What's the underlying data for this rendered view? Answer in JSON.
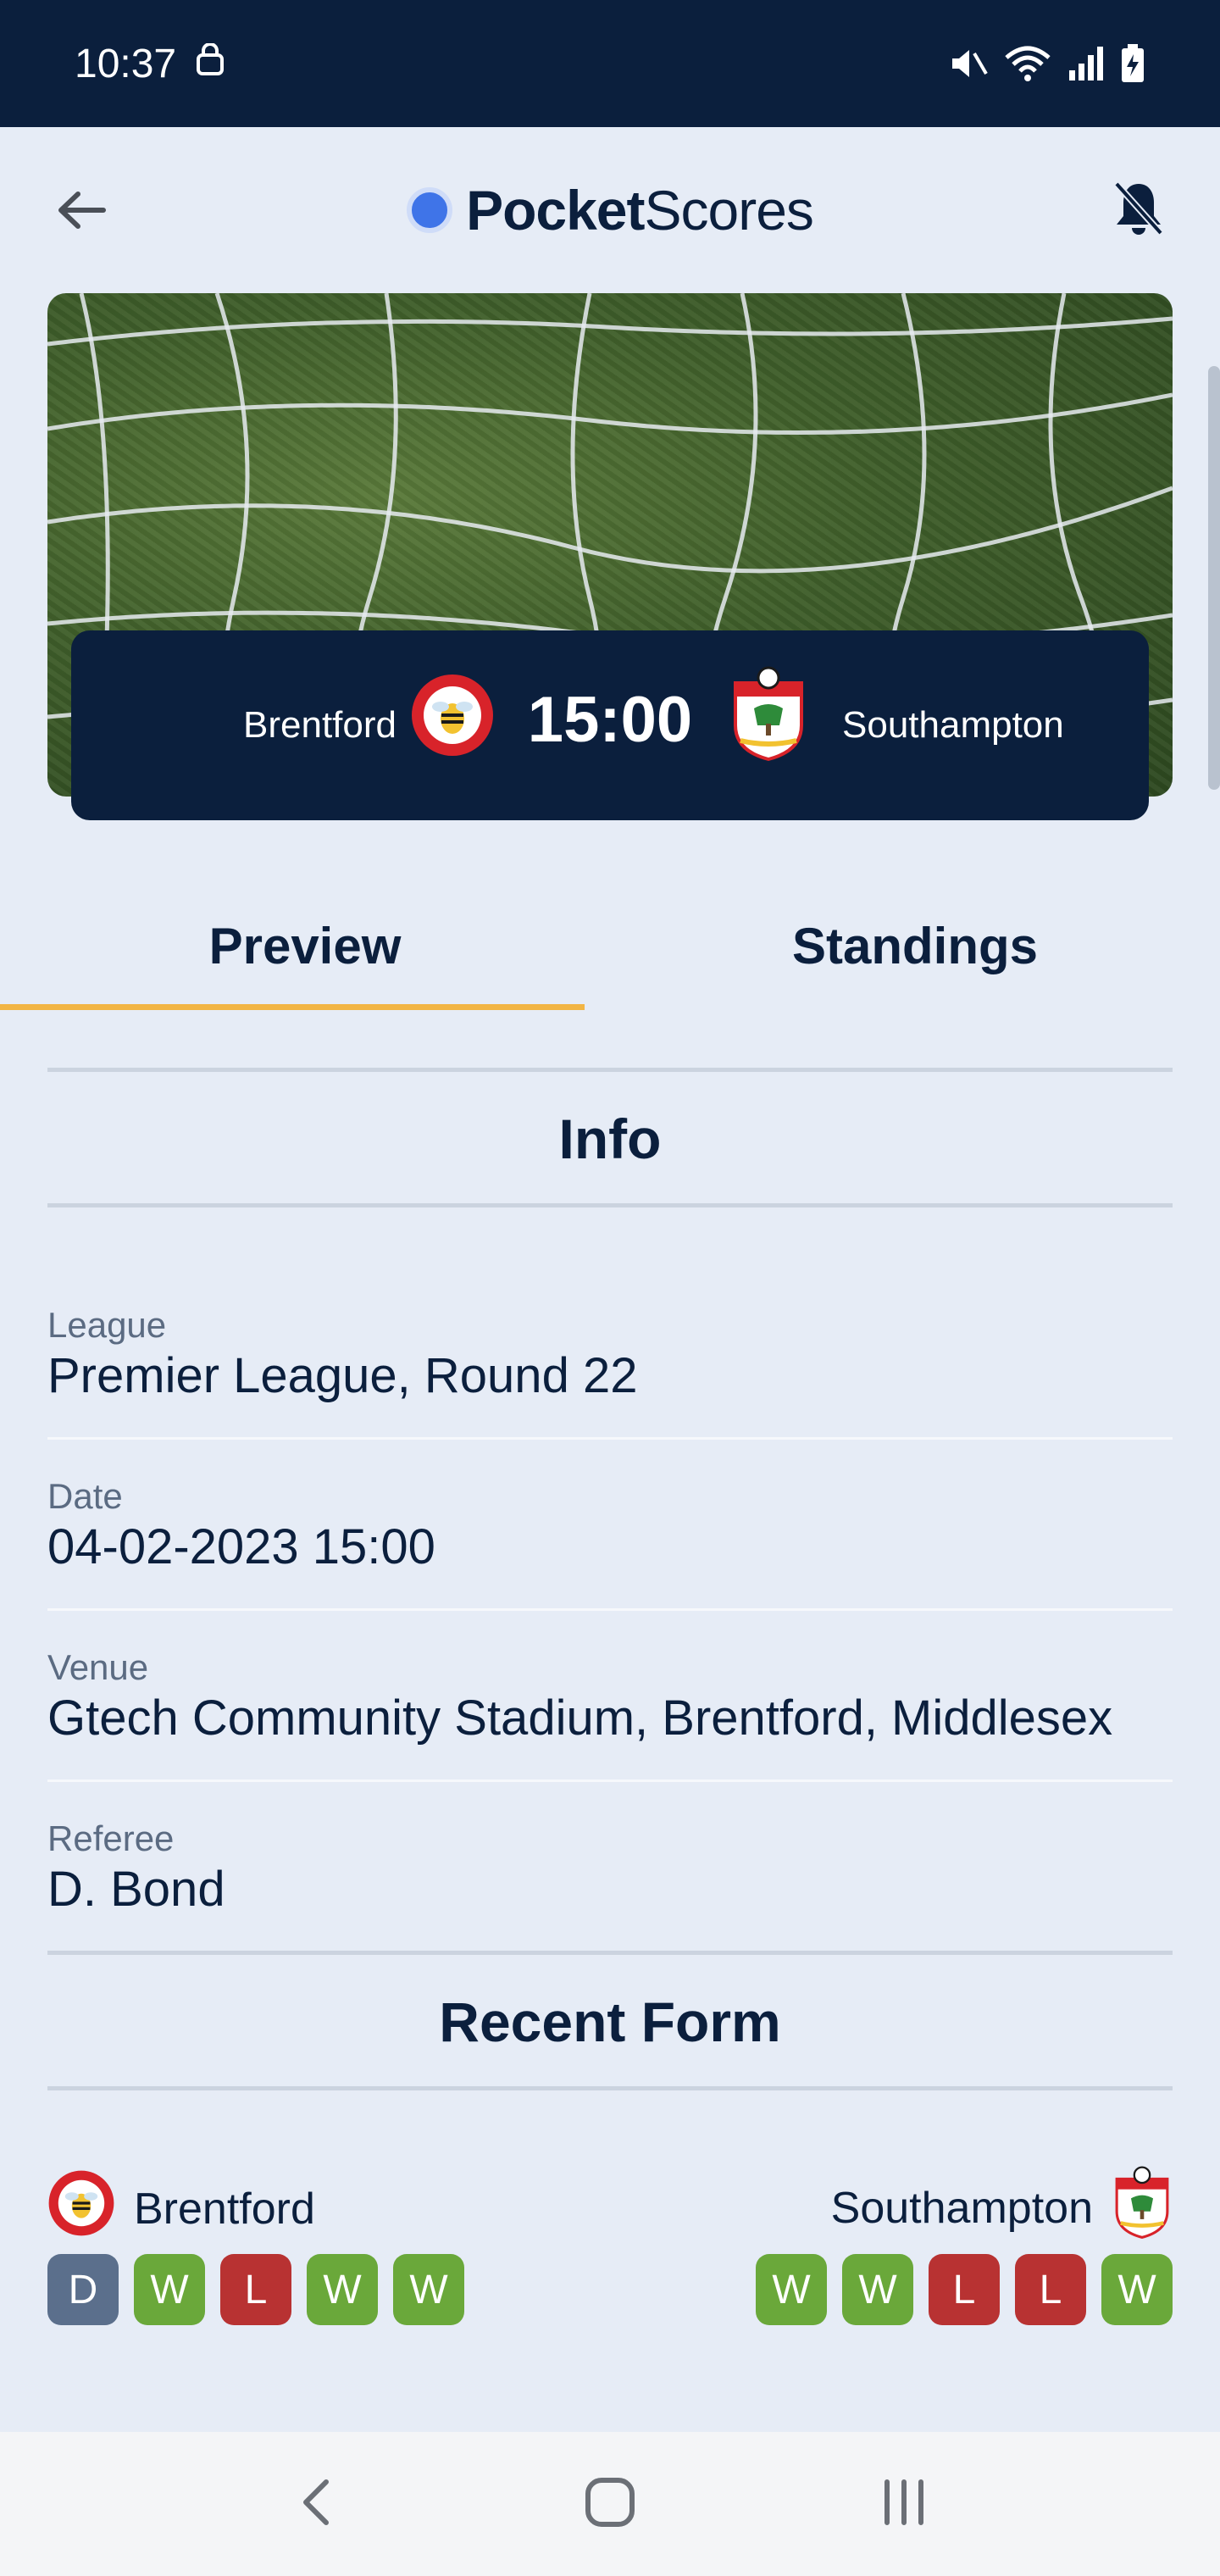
{
  "status_bar": {
    "time": "10:37",
    "icons": [
      "lock-shield-icon",
      "mute-icon",
      "wifi-icon",
      "signal-icon",
      "battery-charging-icon"
    ]
  },
  "app_bar": {
    "brand_bold": "Pocket",
    "brand_light": "Scores",
    "back_icon": "arrow-left-icon",
    "notification_icon": "bell-off-icon"
  },
  "match": {
    "home_team": "Brentford",
    "away_team": "Southampton",
    "time": "15:00"
  },
  "tabs": [
    {
      "label": "Preview",
      "active": true
    },
    {
      "label": "Standings",
      "active": false
    }
  ],
  "info": {
    "title": "Info",
    "rows": [
      {
        "label": "League",
        "value": "Premier League, Round 22"
      },
      {
        "label": "Date",
        "value": "04-02-2023 15:00"
      },
      {
        "label": "Venue",
        "value": "Gtech Community Stadium, Brentford, Middlesex"
      },
      {
        "label": "Referee",
        "value": "D. Bond"
      }
    ]
  },
  "recent_form": {
    "title": "Recent Form",
    "home": {
      "team": "Brentford",
      "results": [
        "D",
        "W",
        "L",
        "W",
        "W"
      ]
    },
    "away": {
      "team": "Southampton",
      "results": [
        "W",
        "W",
        "L",
        "L",
        "W"
      ]
    }
  },
  "colors": {
    "navy": "#0b1f3d",
    "accent": "#f2b544",
    "win": "#6aa83a",
    "loss": "#b83232",
    "draw": "#5b6f8c",
    "background": "#e6ecf6"
  }
}
